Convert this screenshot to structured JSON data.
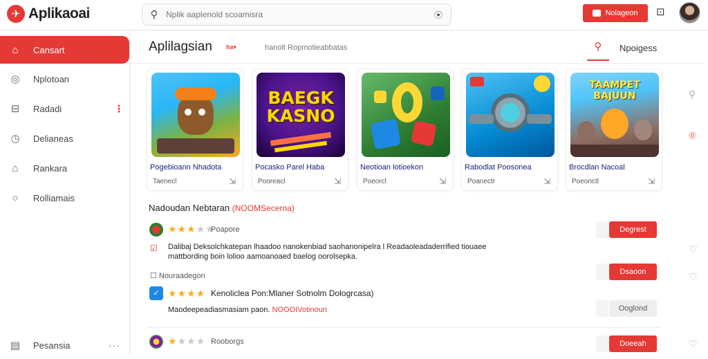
{
  "app": {
    "logo_text": "Aplikaoai"
  },
  "search": {
    "placeholder": "Nplik aaplenold scoamisra"
  },
  "topbar": {
    "action_label": "Nolageon"
  },
  "sidebar": {
    "items": [
      {
        "label": "Cansart",
        "icon": "home-icon"
      },
      {
        "label": "Nplotoan",
        "icon": "compass-icon"
      },
      {
        "label": "Radadi",
        "icon": "shop-icon"
      },
      {
        "label": "Delianeas",
        "icon": "clock-icon"
      },
      {
        "label": "Rankara",
        "icon": "bank-icon"
      },
      {
        "label": "Rolliamais",
        "icon": "circle-icon"
      }
    ],
    "footer_label": "Pesansia"
  },
  "header": {
    "title": "Aplilagsian",
    "flag": "ha▾",
    "subtitle": "hanolt Ropmotieabbatas",
    "tab_label": "Npoigess"
  },
  "cards": [
    {
      "name": "Pogebioann Nhadota",
      "meta": "Taenecl",
      "art_text": ""
    },
    {
      "name": "Pocasko Parel Haba",
      "meta": "Pooreacl",
      "art_text": "BAEGK KASNO"
    },
    {
      "name": "Neotioan lotioekon",
      "meta": "Poeorcl",
      "art_text": ""
    },
    {
      "name": "Rabodlat Poosonea",
      "meta": "Poanectr",
      "art_text": ""
    },
    {
      "name": "Brocdlan Nacoal",
      "meta": "Poeonctl",
      "art_text": "TAAMPET BAJUUN"
    }
  ],
  "section": {
    "title": "Nadoudan Nebtaran",
    "highlight": "(NOOMSecerna)"
  },
  "rows": [
    {
      "tag": "Poapore",
      "stars_on": 3,
      "text_line1": "Dalibaj Deksolchkatepan lhaadoo nanokenbiad saohanonipelra l Readaoleadaderrified tiouaee",
      "text_line2": "mattbording boin lolioo aamoanoaed baelog oorolsepka.",
      "button": "Degrest"
    },
    {
      "tag": "Nouraadegon",
      "button": "Dsaoon"
    },
    {
      "stars_on": 4,
      "title": "Kenoliclea Pon:Mlaner Sotnolm Dologrcasa)",
      "text_line": "Maodeepeadiasmasiam paon.",
      "text_red": "NOOOIVotinoun",
      "button": "Ooglond"
    },
    {
      "tag": "Rooborgs",
      "stars_on": 1,
      "button": "Doeeah"
    }
  ],
  "colors": {
    "accent": "#e53935",
    "star": "#f2b01e"
  }
}
